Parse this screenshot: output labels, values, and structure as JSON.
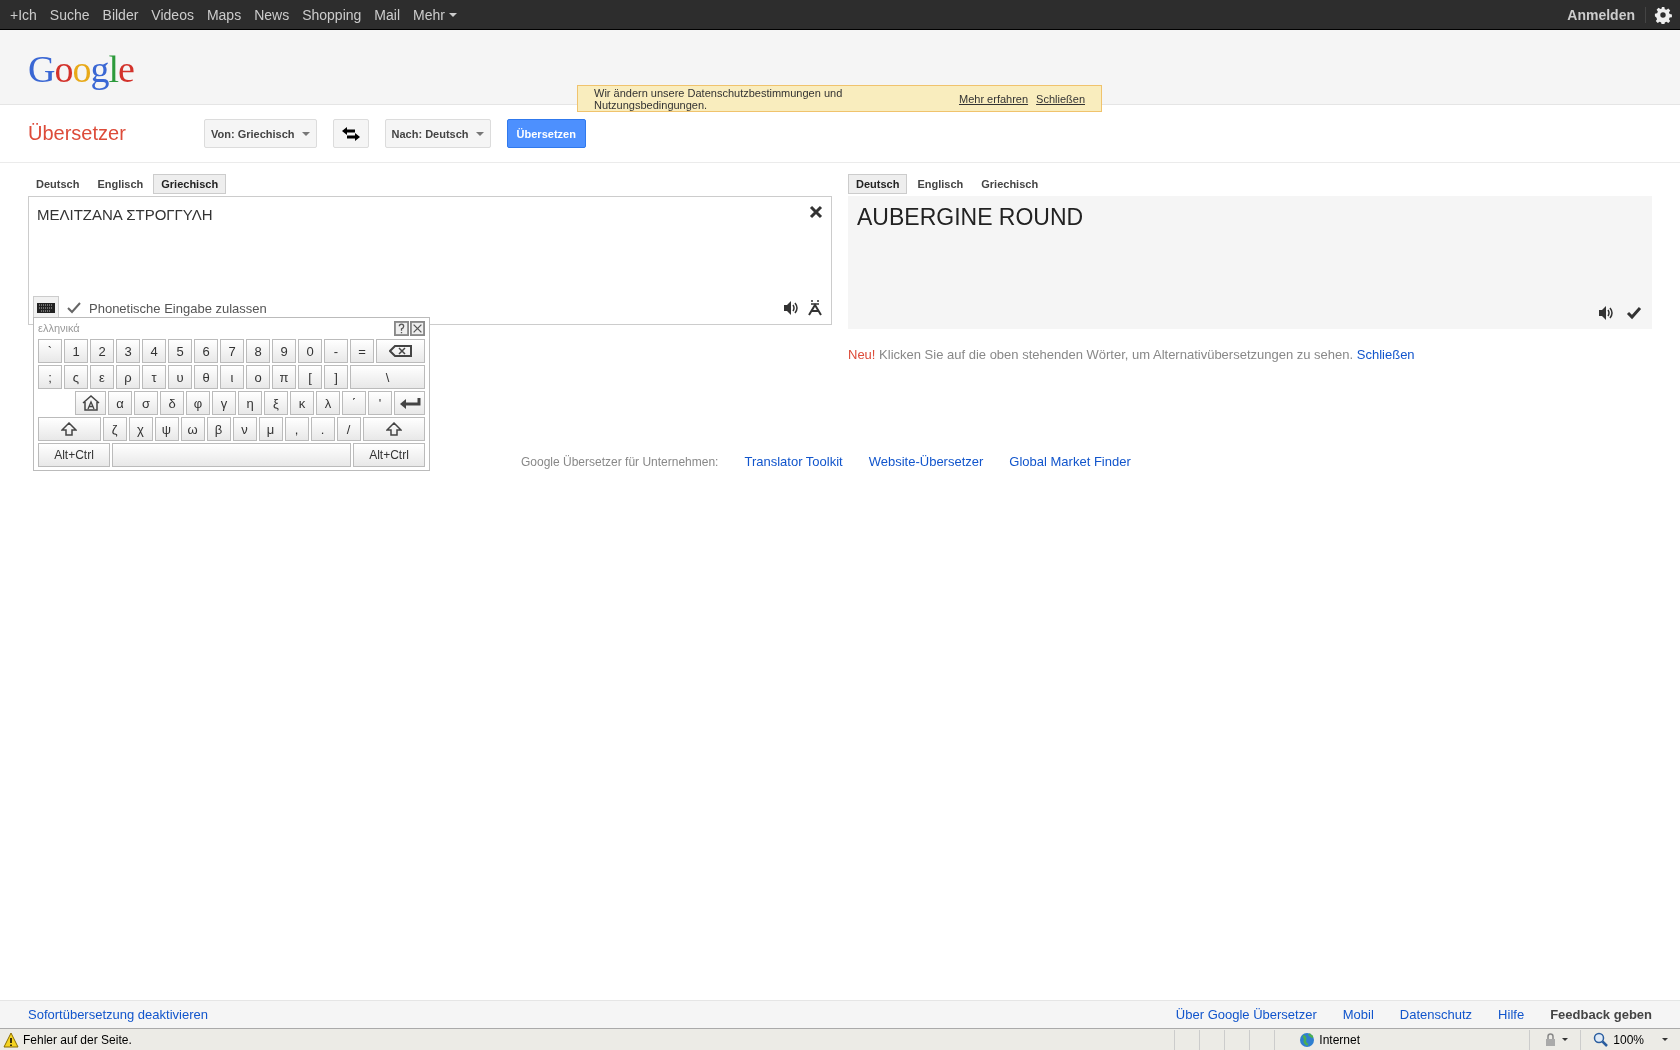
{
  "top_bar": {
    "nav": [
      {
        "label": "+Ich",
        "kind": "link"
      },
      {
        "label": "Suche",
        "kind": "link"
      },
      {
        "label": "Bilder",
        "kind": "link"
      },
      {
        "label": "Videos",
        "kind": "link"
      },
      {
        "label": "Maps",
        "kind": "link"
      },
      {
        "label": "News",
        "kind": "link"
      },
      {
        "label": "Shopping",
        "kind": "link"
      },
      {
        "label": "Mail",
        "kind": "link"
      },
      {
        "label": "Mehr",
        "kind": "menu"
      }
    ],
    "sign_in": "Anmelden"
  },
  "header": {
    "logo": "Google",
    "notice": {
      "text": "Wir ändern unsere Datenschutzbestimmungen und Nutzungsbedingungen.",
      "links": [
        "Mehr erfahren",
        "Schließen"
      ]
    }
  },
  "toolbar": {
    "title": "Übersetzer",
    "source_language": "Von: Griechisch",
    "target_language": "Nach: Deutsch",
    "translate_button": "Übersetzen"
  },
  "source": {
    "tabs": [
      {
        "label": "Deutsch",
        "selected": false
      },
      {
        "label": "Englisch",
        "selected": false
      },
      {
        "label": "Griechisch",
        "selected": true
      }
    ],
    "text": "ΜΕΛΙΤΖΑΝΑ ΣΤΡΟΓΓΥΛΗ",
    "phonetic": {
      "label": "Phonetische Eingabe zulassen",
      "checked": true
    }
  },
  "keyboard": {
    "title": "ελληνικά",
    "rows": [
      {
        "keys": [
          {
            "kind": "char",
            "label": "`"
          },
          {
            "kind": "char",
            "label": "1"
          },
          {
            "kind": "char",
            "label": "2"
          },
          {
            "kind": "char",
            "label": "3"
          },
          {
            "kind": "char",
            "label": "4"
          },
          {
            "kind": "char",
            "label": "5"
          },
          {
            "kind": "char",
            "label": "6"
          },
          {
            "kind": "char",
            "label": "7"
          },
          {
            "kind": "char",
            "label": "8"
          },
          {
            "kind": "char",
            "label": "9"
          },
          {
            "kind": "char",
            "label": "0"
          },
          {
            "kind": "char",
            "label": "-"
          },
          {
            "kind": "char",
            "label": "="
          },
          {
            "kind": "backspace"
          }
        ]
      },
      {
        "keys": [
          {
            "kind": "char",
            "label": ";"
          },
          {
            "kind": "char",
            "label": "ς"
          },
          {
            "kind": "char",
            "label": "ε"
          },
          {
            "kind": "char",
            "label": "ρ"
          },
          {
            "kind": "char",
            "label": "τ"
          },
          {
            "kind": "char",
            "label": "υ"
          },
          {
            "kind": "char",
            "label": "θ"
          },
          {
            "kind": "char",
            "label": "ι"
          },
          {
            "kind": "char",
            "label": "ο"
          },
          {
            "kind": "char",
            "label": "π"
          },
          {
            "kind": "char",
            "label": "["
          },
          {
            "kind": "char",
            "label": "]"
          },
          {
            "kind": "wide",
            "label": "\\"
          }
        ]
      },
      {
        "keys": [
          {
            "kind": "caps"
          },
          {
            "kind": "char",
            "label": "α"
          },
          {
            "kind": "char",
            "label": "σ"
          },
          {
            "kind": "char",
            "label": "δ"
          },
          {
            "kind": "char",
            "label": "φ"
          },
          {
            "kind": "char",
            "label": "γ"
          },
          {
            "kind": "char",
            "label": "η"
          },
          {
            "kind": "char",
            "label": "ξ"
          },
          {
            "kind": "char",
            "label": "κ"
          },
          {
            "kind": "char",
            "label": "λ"
          },
          {
            "kind": "char",
            "label": "΄"
          },
          {
            "kind": "char",
            "label": "'"
          },
          {
            "kind": "enter"
          }
        ]
      },
      {
        "keys": [
          {
            "kind": "shift"
          },
          {
            "kind": "char",
            "label": "ζ"
          },
          {
            "kind": "char",
            "label": "χ"
          },
          {
            "kind": "char",
            "label": "ψ"
          },
          {
            "kind": "char",
            "label": "ω"
          },
          {
            "kind": "char",
            "label": "β"
          },
          {
            "kind": "char",
            "label": "ν"
          },
          {
            "kind": "char",
            "label": "μ"
          },
          {
            "kind": "char",
            "label": ","
          },
          {
            "kind": "char",
            "label": "."
          },
          {
            "kind": "char",
            "label": "/"
          },
          {
            "kind": "shift"
          }
        ]
      },
      {
        "keys": [
          {
            "kind": "modifier",
            "label": "Alt+Ctrl"
          },
          {
            "kind": "space"
          },
          {
            "kind": "modifier",
            "label": "Alt+Ctrl"
          }
        ]
      }
    ]
  },
  "target": {
    "tabs": [
      {
        "label": "Deutsch",
        "selected": true
      },
      {
        "label": "Englisch",
        "selected": false
      },
      {
        "label": "Griechisch",
        "selected": false
      }
    ],
    "text": "AUBERGINE ROUND",
    "hint": {
      "badge": "Neu!",
      "text": "Klicken Sie auf die oben stehenden Wörter, um Alternativübersetzungen zu sehen.",
      "link": "Schließen"
    }
  },
  "business": {
    "label": "Google Übersetzer für Unternehmen:",
    "links": [
      "Translator Toolkit",
      "Website-Übersetzer",
      "Global Market Finder"
    ]
  },
  "footer": {
    "left_link": "Sofortübersetzung deaktivieren",
    "links": [
      {
        "label": "Über Google Übersetzer",
        "kind": "link"
      },
      {
        "label": "Mobil",
        "kind": "link"
      },
      {
        "label": "Datenschutz",
        "kind": "link"
      },
      {
        "label": "Hilfe",
        "kind": "link"
      },
      {
        "label": "Feedback geben",
        "kind": "feedback"
      }
    ]
  },
  "status_bar": {
    "message": "Fehler auf der Seite.",
    "zone": "Internet",
    "zoom": "100%"
  }
}
